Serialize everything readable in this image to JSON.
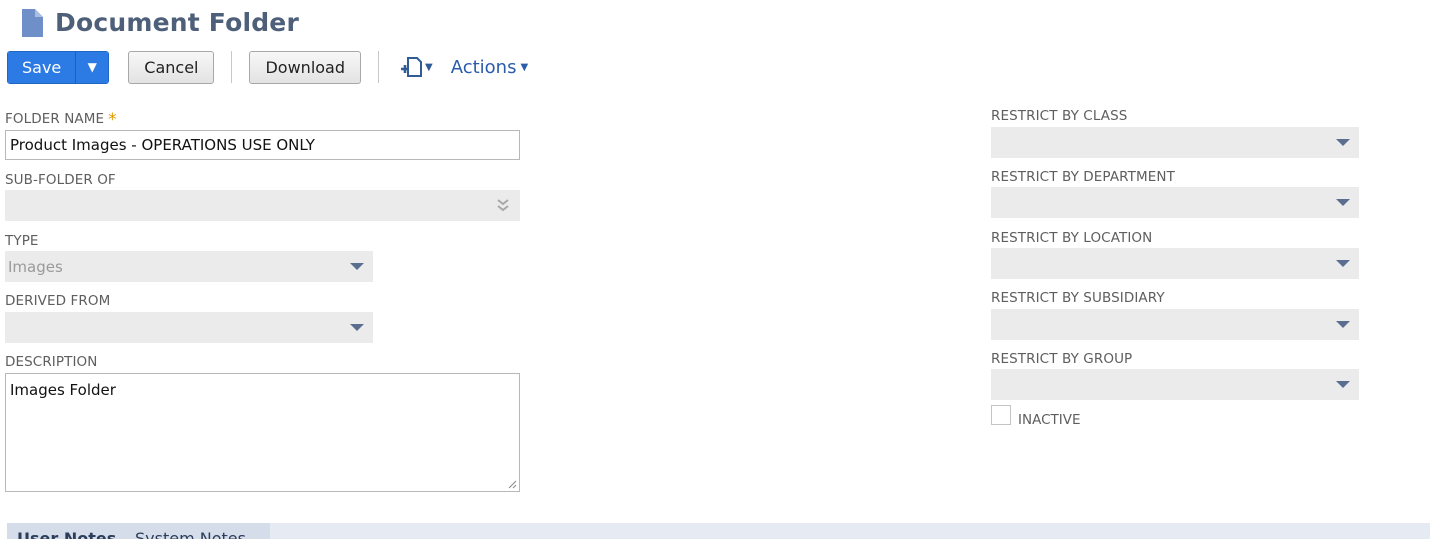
{
  "header": {
    "title": "Document Folder",
    "icon": "document-icon"
  },
  "toolbar": {
    "save_label": "Save",
    "save_menu_icon": "chevron-down-icon",
    "cancel_label": "Cancel",
    "download_label": "Download",
    "print_icon": "print-icon",
    "actions_label": "Actions"
  },
  "fields": {
    "folder_name": {
      "label": "FOLDER NAME",
      "required_mark": "*",
      "value": "Product Images - OPERATIONS USE ONLY"
    },
    "sub_folder_of": {
      "label": "SUB-FOLDER OF",
      "value": ""
    },
    "type": {
      "label": "TYPE",
      "value": "Images"
    },
    "derived_from": {
      "label": "DERIVED FROM",
      "value": ""
    },
    "description": {
      "label": "DESCRIPTION",
      "value": "Images Folder"
    },
    "restrict_class": {
      "label": "RESTRICT BY CLASS",
      "value": ""
    },
    "restrict_department": {
      "label": "RESTRICT BY DEPARTMENT",
      "value": ""
    },
    "restrict_location": {
      "label": "RESTRICT BY LOCATION",
      "value": ""
    },
    "restrict_subsidiary": {
      "label": "RESTRICT BY SUBSIDIARY",
      "value": ""
    },
    "restrict_group": {
      "label": "RESTRICT BY GROUP",
      "value": ""
    },
    "inactive": {
      "label": "INACTIVE",
      "checked": false
    }
  },
  "tabs": [
    {
      "label": "User Notes",
      "active": true
    },
    {
      "label": "System Notes",
      "active": false
    }
  ],
  "colors": {
    "accent": "#2c7ae3",
    "title": "#4d5f79",
    "link": "#2a5caa",
    "required": "#e09a00"
  }
}
